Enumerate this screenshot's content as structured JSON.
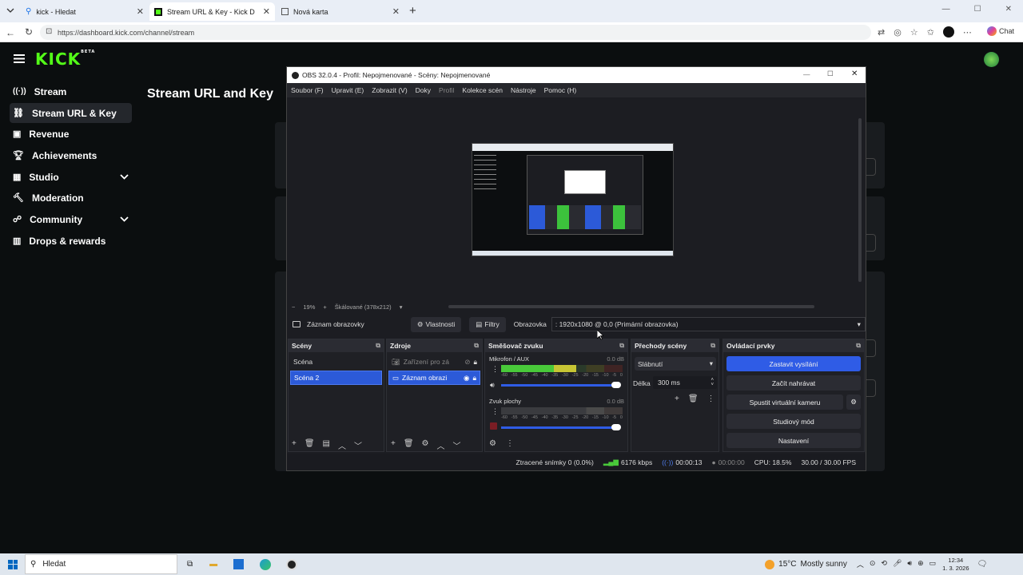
{
  "browser": {
    "tabs": [
      {
        "label": "kick - Hledat"
      },
      {
        "label": "Stream URL & Key - Kick Dashboar"
      },
      {
        "label": "Nová karta"
      }
    ],
    "url": "https://dashboard.kick.com/channel/stream",
    "chat_label": "Chat"
  },
  "kick": {
    "logo": "KICK",
    "logo_badge": "BETA",
    "nav": [
      {
        "label": "Stream",
        "icon": "broadcast-icon"
      },
      {
        "label": "Stream URL & Key",
        "icon": "link-icon",
        "active": true
      },
      {
        "label": "Revenue",
        "icon": "dollar-icon"
      },
      {
        "label": "Achievements",
        "icon": "trophy-icon"
      },
      {
        "label": "Studio",
        "icon": "layout-icon",
        "expandable": true
      },
      {
        "label": "Moderation",
        "icon": "hammer-icon"
      },
      {
        "label": "Community",
        "icon": "people-icon",
        "expandable": true
      },
      {
        "label": "Drops & rewards",
        "icon": "gift-icon"
      }
    ],
    "page_title": "Stream URL and Key"
  },
  "obs": {
    "title": "OBS 32.0.4 - Profil: Nepojmenované - Scény: Nepojmenované",
    "menu": [
      "Soubor (F)",
      "Upravit (E)",
      "Zobrazit (V)",
      "Doky",
      "Profil",
      "Kolekce scén",
      "Nástroje",
      "Pomoc (H)"
    ],
    "zoom": {
      "minus": "−",
      "value": "19%",
      "plus": "+",
      "scale_label": "Škálované (378x212)"
    },
    "source_bar": {
      "source_name": "Záznam obrazovky",
      "properties": "Vlastnosti",
      "filters": "Filtry",
      "screen_label": "Obrazovka",
      "screen_value": ": 1920x1080 @ 0,0 (Primární obrazovka)"
    },
    "scenes": {
      "title": "Scény",
      "items": [
        "Scéna",
        "Scéna 2"
      ],
      "selected": 1
    },
    "sources": {
      "title": "Zdroje",
      "items": [
        "Zařízení pro zá",
        "Záznam obrazi"
      ],
      "selected": 1
    },
    "mixer": {
      "title": "Směšovač zvuku",
      "channels": [
        {
          "name": "Mikrofon / AUX",
          "db": "0.0 dB",
          "level": 0.62
        },
        {
          "name": "Zvuk plochy",
          "db": "0.0 dB",
          "level": 0
        }
      ],
      "ticks": [
        "-60",
        "-55",
        "-50",
        "-45",
        "-40",
        "-35",
        "-30",
        "-25",
        "-20",
        "-15",
        "-10",
        "-5",
        "0"
      ]
    },
    "transitions": {
      "title": "Přechody scény",
      "selected": "Slábnutí",
      "duration_label": "Délka",
      "duration_value": "300 ms"
    },
    "controls": {
      "title": "Ovládací prvky",
      "buttons": [
        "Zastavit vysílání",
        "Začít nahrávat",
        "Spustit virtuální kameru",
        "Studiový mód",
        "Nastavení"
      ]
    },
    "status": {
      "dropped": "Ztracené snímky 0 (0.0%)",
      "bitrate": "6176 kbps",
      "stream_time": "00:00:13",
      "rec_time": "00:00:00",
      "cpu": "CPU: 18.5%",
      "fps": "30.00 / 30.00 FPS"
    }
  },
  "taskbar": {
    "search": "Hledat",
    "weather_temp": "15°C",
    "weather_text": "Mostly sunny",
    "time": "12:34",
    "date": "1. 3. 2026"
  }
}
